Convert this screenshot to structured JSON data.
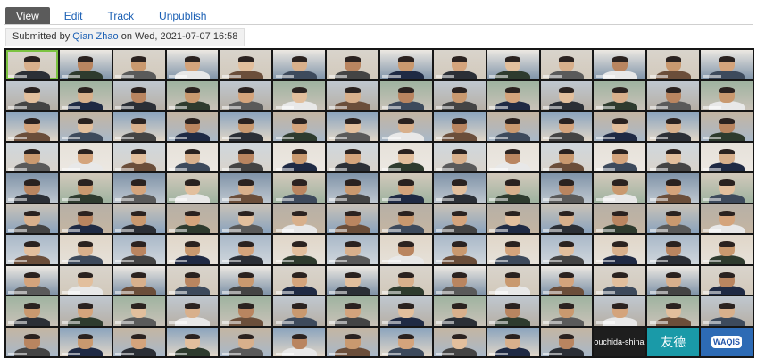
{
  "tabs": [
    {
      "label": "View",
      "active": true
    },
    {
      "label": "Edit",
      "active": false
    },
    {
      "label": "Track",
      "active": false
    },
    {
      "label": "Unpublish",
      "active": false
    }
  ],
  "submitted": {
    "prefix": "Submitted by",
    "author": "Qian Zhao",
    "suffix": "on Wed, 2021-07-07 16:58"
  },
  "video_grid": {
    "columns": 14,
    "rows": 10,
    "text_tiles": [
      {
        "index": 137,
        "text": "ouchida-shinanga",
        "kind": "plain",
        "bg": "#1e1e1e"
      },
      {
        "index": 138,
        "text": "友德",
        "kind": "cjk",
        "bg": "#1a9aa8"
      },
      {
        "index": 139,
        "text": "WAQIS",
        "kind": "logo",
        "bg": "#2d6bb5"
      }
    ],
    "active_speaker_index": 0
  },
  "colors": {
    "tab_active_bg": "#5b5b5b",
    "link": "#1a5fb4",
    "grid_bg": "#161616"
  }
}
